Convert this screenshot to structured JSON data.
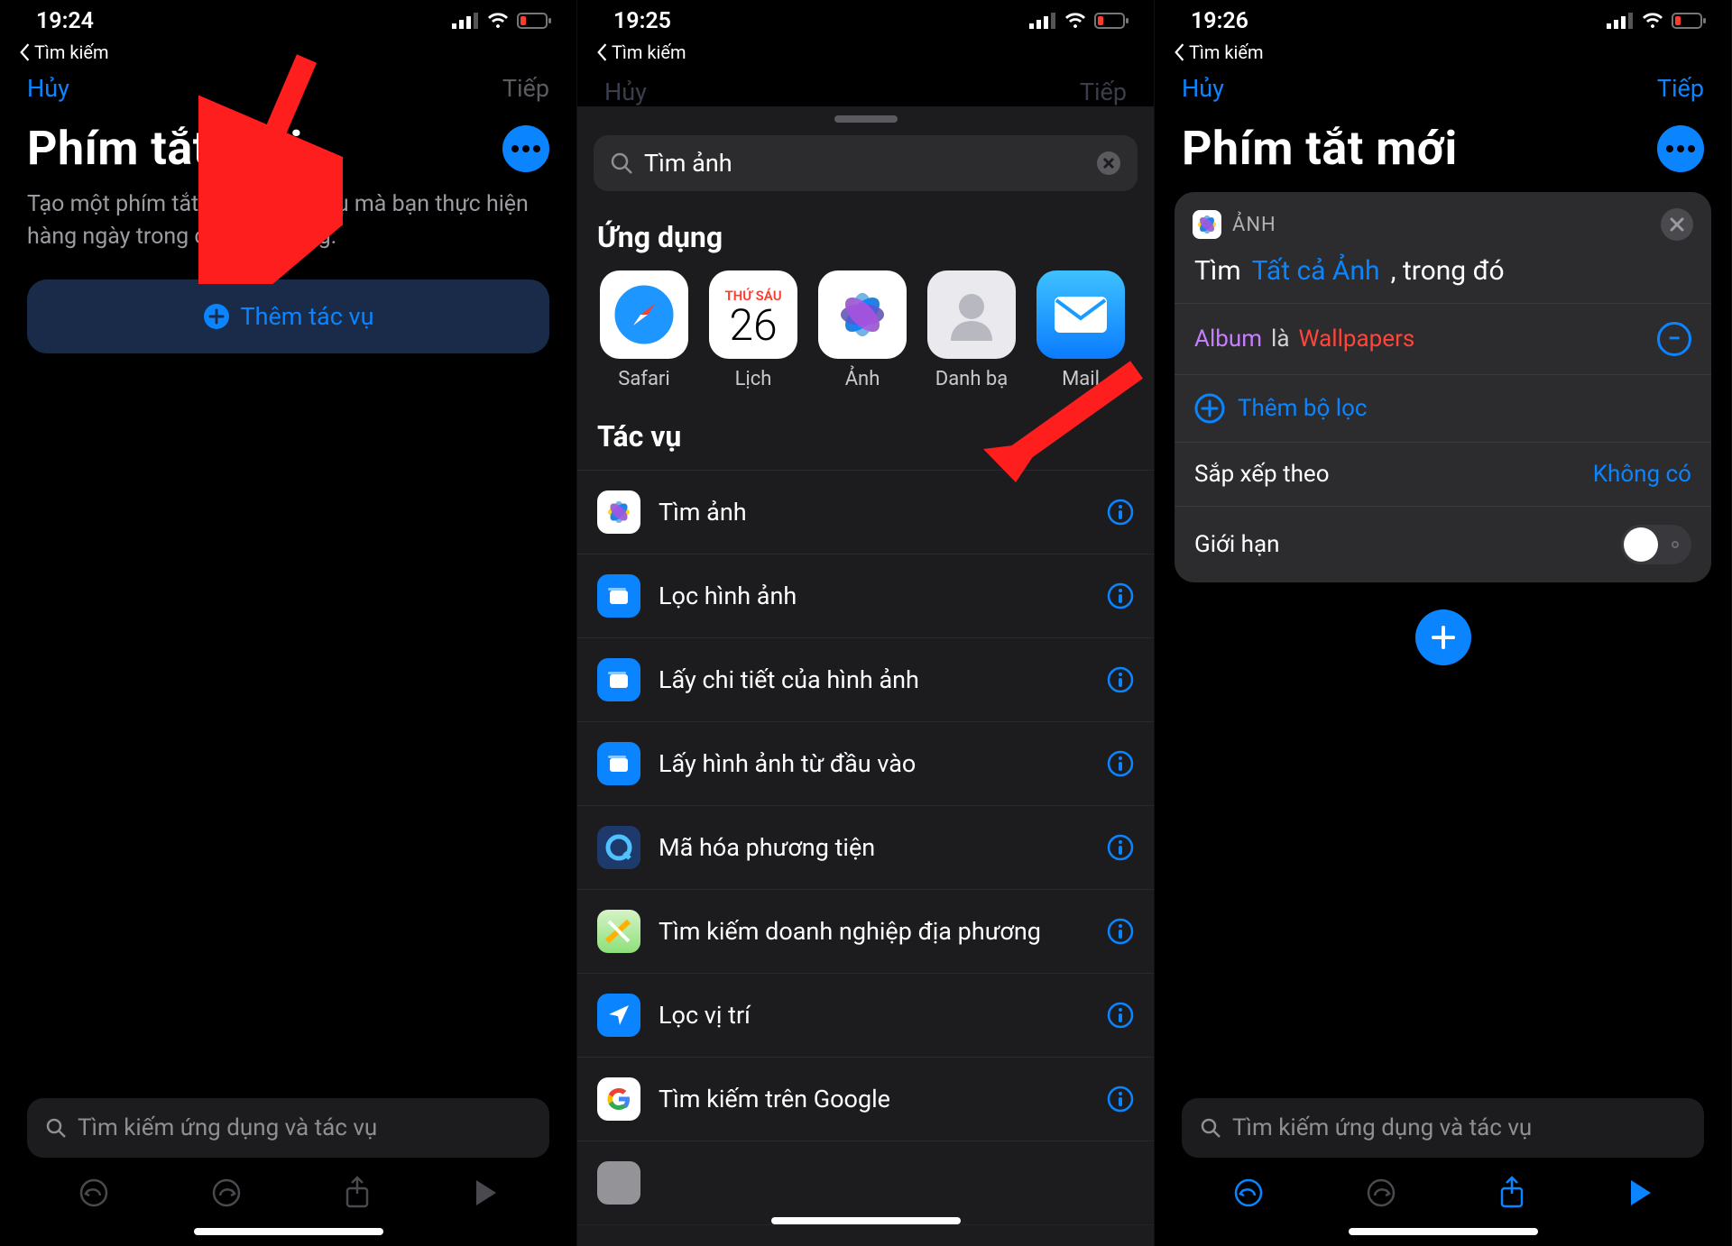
{
  "status": {
    "back_label": "Tìm kiếm"
  },
  "screen1": {
    "time": "19:24",
    "nav": {
      "cancel": "Hủy",
      "next": "Tiếp"
    },
    "title": "Phím tắt mới",
    "desc_l1": "Tạo một phím tắt cho các tác vụ mà bạn thực hiện",
    "desc_l2": "hàng ngày trong các ứng dụng.",
    "add_action": "Thêm tác vụ",
    "search_ph": "Tìm kiếm ứng dụng và tác vụ"
  },
  "screen2": {
    "time": "19:25",
    "nav": {
      "cancel": "Hủy",
      "next": "Tiếp"
    },
    "search_value": "Tìm ảnh",
    "section_apps": "Ứng dụng",
    "apps": [
      {
        "label": "Safari"
      },
      {
        "label": "Lịch",
        "weekday_label": "THỨ SÁU",
        "day": "26"
      },
      {
        "label": "Ảnh"
      },
      {
        "label": "Danh bạ"
      },
      {
        "label": "Mail"
      }
    ],
    "section_actions": "Tác vụ",
    "actions": [
      {
        "label": "Tìm ảnh",
        "icon": "photos"
      },
      {
        "label": "Lọc hình ảnh",
        "icon": "blue"
      },
      {
        "label": "Lấy chi tiết của hình ảnh",
        "icon": "blue"
      },
      {
        "label": "Lấy hình ảnh từ đầu vào",
        "icon": "blue"
      },
      {
        "label": "Mã hóa phương tiện",
        "icon": "qt"
      },
      {
        "label": "Tìm kiếm doanh nghiệp địa phương",
        "icon": "maps"
      },
      {
        "label": "Lọc vị trí",
        "icon": "loc"
      },
      {
        "label": "Tìm kiếm trên Google",
        "icon": "google"
      }
    ]
  },
  "screen3": {
    "time": "19:26",
    "nav": {
      "cancel": "Hủy",
      "next": "Tiếp"
    },
    "title": "Phím tắt mới",
    "card": {
      "app_name": "ẢNH",
      "line_prefix": "Tìm",
      "line_var": "Tất cả Ảnh",
      "line_suffix": ", trong đó",
      "filter": {
        "k": "Album",
        "op": "là",
        "v": "Wallpapers"
      },
      "add_filter": "Thêm bộ lọc",
      "sort_label": "Sắp xếp theo",
      "sort_value": "Không có",
      "limit_label": "Giới hạn"
    },
    "search_ph": "Tìm kiếm ứng dụng và tác vụ"
  }
}
